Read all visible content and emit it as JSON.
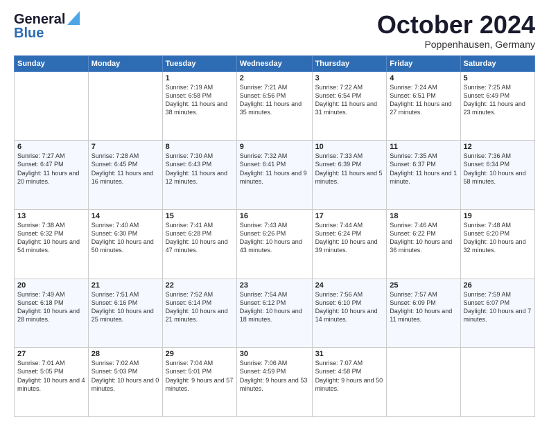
{
  "logo": {
    "line1": "General",
    "line2": "Blue"
  },
  "header": {
    "title": "October 2024",
    "location": "Poppenhausen, Germany"
  },
  "days_of_week": [
    "Sunday",
    "Monday",
    "Tuesday",
    "Wednesday",
    "Thursday",
    "Friday",
    "Saturday"
  ],
  "weeks": [
    [
      {
        "day": "",
        "detail": ""
      },
      {
        "day": "",
        "detail": ""
      },
      {
        "day": "1",
        "detail": "Sunrise: 7:19 AM\nSunset: 6:58 PM\nDaylight: 11 hours and 38 minutes."
      },
      {
        "day": "2",
        "detail": "Sunrise: 7:21 AM\nSunset: 6:56 PM\nDaylight: 11 hours and 35 minutes."
      },
      {
        "day": "3",
        "detail": "Sunrise: 7:22 AM\nSunset: 6:54 PM\nDaylight: 11 hours and 31 minutes."
      },
      {
        "day": "4",
        "detail": "Sunrise: 7:24 AM\nSunset: 6:51 PM\nDaylight: 11 hours and 27 minutes."
      },
      {
        "day": "5",
        "detail": "Sunrise: 7:25 AM\nSunset: 6:49 PM\nDaylight: 11 hours and 23 minutes."
      }
    ],
    [
      {
        "day": "6",
        "detail": "Sunrise: 7:27 AM\nSunset: 6:47 PM\nDaylight: 11 hours and 20 minutes."
      },
      {
        "day": "7",
        "detail": "Sunrise: 7:28 AM\nSunset: 6:45 PM\nDaylight: 11 hours and 16 minutes."
      },
      {
        "day": "8",
        "detail": "Sunrise: 7:30 AM\nSunset: 6:43 PM\nDaylight: 11 hours and 12 minutes."
      },
      {
        "day": "9",
        "detail": "Sunrise: 7:32 AM\nSunset: 6:41 PM\nDaylight: 11 hours and 9 minutes."
      },
      {
        "day": "10",
        "detail": "Sunrise: 7:33 AM\nSunset: 6:39 PM\nDaylight: 11 hours and 5 minutes."
      },
      {
        "day": "11",
        "detail": "Sunrise: 7:35 AM\nSunset: 6:37 PM\nDaylight: 11 hours and 1 minute."
      },
      {
        "day": "12",
        "detail": "Sunrise: 7:36 AM\nSunset: 6:34 PM\nDaylight: 10 hours and 58 minutes."
      }
    ],
    [
      {
        "day": "13",
        "detail": "Sunrise: 7:38 AM\nSunset: 6:32 PM\nDaylight: 10 hours and 54 minutes."
      },
      {
        "day": "14",
        "detail": "Sunrise: 7:40 AM\nSunset: 6:30 PM\nDaylight: 10 hours and 50 minutes."
      },
      {
        "day": "15",
        "detail": "Sunrise: 7:41 AM\nSunset: 6:28 PM\nDaylight: 10 hours and 47 minutes."
      },
      {
        "day": "16",
        "detail": "Sunrise: 7:43 AM\nSunset: 6:26 PM\nDaylight: 10 hours and 43 minutes."
      },
      {
        "day": "17",
        "detail": "Sunrise: 7:44 AM\nSunset: 6:24 PM\nDaylight: 10 hours and 39 minutes."
      },
      {
        "day": "18",
        "detail": "Sunrise: 7:46 AM\nSunset: 6:22 PM\nDaylight: 10 hours and 36 minutes."
      },
      {
        "day": "19",
        "detail": "Sunrise: 7:48 AM\nSunset: 6:20 PM\nDaylight: 10 hours and 32 minutes."
      }
    ],
    [
      {
        "day": "20",
        "detail": "Sunrise: 7:49 AM\nSunset: 6:18 PM\nDaylight: 10 hours and 28 minutes."
      },
      {
        "day": "21",
        "detail": "Sunrise: 7:51 AM\nSunset: 6:16 PM\nDaylight: 10 hours and 25 minutes."
      },
      {
        "day": "22",
        "detail": "Sunrise: 7:52 AM\nSunset: 6:14 PM\nDaylight: 10 hours and 21 minutes."
      },
      {
        "day": "23",
        "detail": "Sunrise: 7:54 AM\nSunset: 6:12 PM\nDaylight: 10 hours and 18 minutes."
      },
      {
        "day": "24",
        "detail": "Sunrise: 7:56 AM\nSunset: 6:10 PM\nDaylight: 10 hours and 14 minutes."
      },
      {
        "day": "25",
        "detail": "Sunrise: 7:57 AM\nSunset: 6:09 PM\nDaylight: 10 hours and 11 minutes."
      },
      {
        "day": "26",
        "detail": "Sunrise: 7:59 AM\nSunset: 6:07 PM\nDaylight: 10 hours and 7 minutes."
      }
    ],
    [
      {
        "day": "27",
        "detail": "Sunrise: 7:01 AM\nSunset: 5:05 PM\nDaylight: 10 hours and 4 minutes."
      },
      {
        "day": "28",
        "detail": "Sunrise: 7:02 AM\nSunset: 5:03 PM\nDaylight: 10 hours and 0 minutes."
      },
      {
        "day": "29",
        "detail": "Sunrise: 7:04 AM\nSunset: 5:01 PM\nDaylight: 9 hours and 57 minutes."
      },
      {
        "day": "30",
        "detail": "Sunrise: 7:06 AM\nSunset: 4:59 PM\nDaylight: 9 hours and 53 minutes."
      },
      {
        "day": "31",
        "detail": "Sunrise: 7:07 AM\nSunset: 4:58 PM\nDaylight: 9 hours and 50 minutes."
      },
      {
        "day": "",
        "detail": ""
      },
      {
        "day": "",
        "detail": ""
      }
    ]
  ]
}
